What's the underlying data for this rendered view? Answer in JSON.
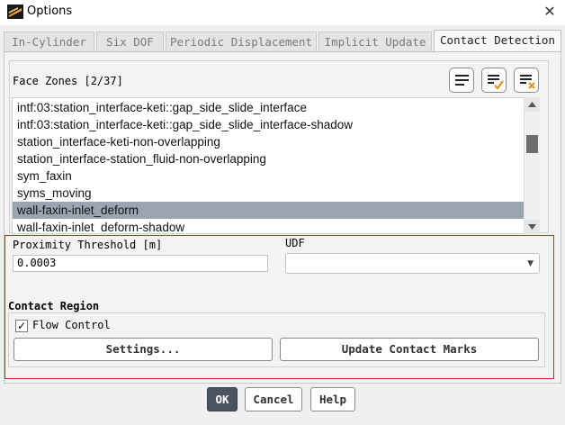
{
  "window": {
    "title": "Options",
    "close_label": "✕"
  },
  "tabs": [
    {
      "label": "In-Cylinder"
    },
    {
      "label": "Six DOF"
    },
    {
      "label": "Periodic Displacement"
    },
    {
      "label": "Implicit Update"
    },
    {
      "label": "Contact Detection",
      "active": true
    }
  ],
  "face_zones": {
    "label": "Face Zones [2/37]",
    "items": [
      {
        "label": "intf:03:station_interface-keti::gap_side_slide_interface",
        "selected": false
      },
      {
        "label": "intf:03:station_interface-keti::gap_side_slide_interface-shadow",
        "selected": false
      },
      {
        "label": "station_interface-keti-non-overlapping",
        "selected": false
      },
      {
        "label": "station_interface-station_fluid-non-overlapping",
        "selected": false
      },
      {
        "label": "sym_faxin",
        "selected": false
      },
      {
        "label": "syms_moving",
        "selected": false
      },
      {
        "label": "wall-faxin-inlet_deform",
        "selected": true
      },
      {
        "label": "wall-faxin-inlet_deform-shadow",
        "selected": false
      }
    ]
  },
  "proximity": {
    "label": "Proximity Threshold [m]",
    "value": "0.0003"
  },
  "udf": {
    "label": "UDF",
    "selected": ""
  },
  "contact_region": {
    "label": "Contact Region",
    "flow_control_label": "Flow Control",
    "flow_control_checked": true,
    "check_glyph": "✓",
    "settings_label": "Settings...",
    "update_label": "Update Contact Marks"
  },
  "footer": {
    "ok_label": "OK",
    "cancel_label": "Cancel",
    "help_label": "Help"
  },
  "colors": {
    "accent_selection": "#9aa5b1",
    "highlight_box": "#e02020",
    "ok_button": "#4a5460"
  },
  "icons": [
    "app-logo-icon",
    "close-icon",
    "select-all-icon",
    "select-check-icon",
    "deselect-icon",
    "scroll-up-icon",
    "scroll-down-icon",
    "dropdown-arrow-icon"
  ]
}
